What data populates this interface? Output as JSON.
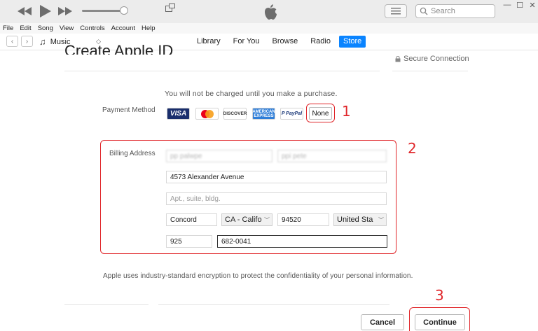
{
  "titlebar": {
    "search_placeholder": "Search",
    "window_controls": [
      "—",
      "☐",
      "✕"
    ]
  },
  "menubar": {
    "items": [
      "File",
      "Edit",
      "Song",
      "View",
      "Controls",
      "Account",
      "Help"
    ]
  },
  "navbar": {
    "media_selector": "Music",
    "tabs": [
      {
        "label": "Library",
        "active": false
      },
      {
        "label": "For You",
        "active": false
      },
      {
        "label": "Browse",
        "active": false
      },
      {
        "label": "Radio",
        "active": false
      },
      {
        "label": "Store",
        "active": true
      }
    ]
  },
  "page": {
    "title": "Create Apple ID",
    "secure_label": "Secure Connection",
    "charge_note": "You will not be charged until you make a purchase.",
    "payment_label": "Payment Method",
    "payment_options": {
      "visa": "VISA",
      "discover": "DISCOVER",
      "amex": "AMERICAN EXPRESS",
      "paypal": "P PayPal",
      "none": "None"
    },
    "billing_label": "Billing Address",
    "billing": {
      "first_name": "pp palwpe",
      "last_name": "ppi pete",
      "street": "4573 Alexander Avenue",
      "apt_placeholder": "Apt., suite, bldg.",
      "city": "Concord",
      "state": "CA - Califo",
      "zip": "94520",
      "country": "United Sta",
      "area_code": "925",
      "phone": "682-0041"
    },
    "disclaimer": "Apple uses industry-standard encryption to protect the confidentiality of your personal information.",
    "cancel_label": "Cancel",
    "continue_label": "Continue"
  },
  "annotations": [
    "1",
    "2",
    "3"
  ],
  "colors": {
    "annotation": "#e0262a",
    "active_tab": "#0a84ff",
    "visa": "#1a2e6c",
    "amex": "#2f7ed8"
  }
}
